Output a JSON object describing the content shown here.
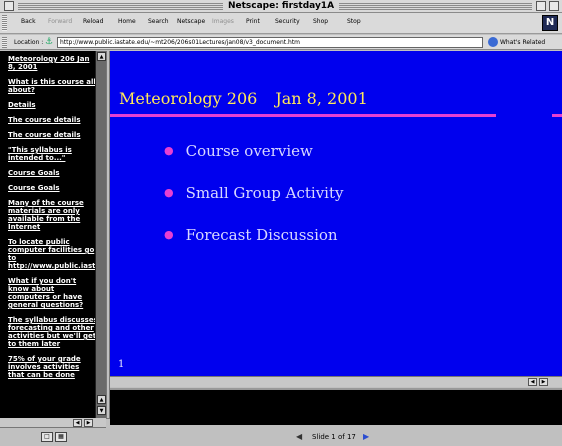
{
  "window": {
    "title": "Netscape: firstday1A"
  },
  "toolbar": {
    "buttons": [
      "Back",
      "Forward",
      "Reload",
      "Home",
      "Search",
      "Netscape",
      "Images",
      "Print",
      "Security",
      "Shop",
      "Stop"
    ]
  },
  "location": {
    "label": "Location :",
    "url": "http://www.public.iastate.edu/~mt206/206s01Lectures/jan08/v3_document.htm",
    "related": "What's Related"
  },
  "sidebar": {
    "links": [
      "Meteorology 206 Jan 8, 2001",
      "What is this course all about?",
      "Details",
      "The course details",
      "The course details",
      "\"This syllabus is intended to...\"",
      "Course Goals",
      "Course Goals",
      "Many of the course materials are only available from the Internet",
      "To locate public computer facilities go to http://www.public.iastat",
      "What if you don't know about computers or have general questions?",
      "The syllabus discusses forecasting and other activities but we'll get to them later",
      "75% of your grade involves activities that can be done"
    ]
  },
  "slide": {
    "course": "Meteorology 206",
    "date": "Jan 8, 2001",
    "bullets": [
      "Course overview",
      "Small Group Activity",
      "Forecast Discussion"
    ],
    "number": "1"
  },
  "slide_nav": {
    "text": "Slide 1 of 17"
  },
  "colors": {
    "slide_bg": "#0000ee",
    "title": "#ffe85a",
    "accent": "#e640d2",
    "sidebar_bg": "#000000"
  }
}
